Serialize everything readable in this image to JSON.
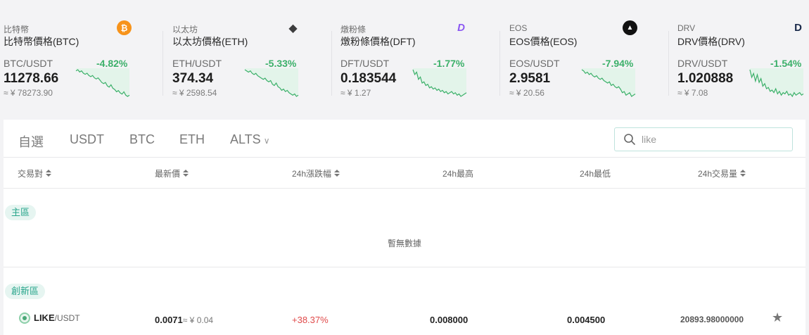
{
  "tickers": [
    {
      "short": "比特幣",
      "full": "比特幣價格(BTC)",
      "pair": "BTC/USDT",
      "change": "-4.82%",
      "price": "11278.66",
      "cny": "≈ ¥ 78273.90",
      "icon": "bitcoin-icon",
      "icon_glyph": "₿",
      "icon_color": "#f7931a",
      "spark": [
        12,
        11,
        13,
        12,
        14,
        15,
        14,
        16,
        17,
        16,
        18,
        19,
        18,
        20,
        22,
        23,
        22,
        25,
        26,
        24,
        27,
        28,
        30,
        29,
        31,
        32,
        30,
        33,
        34,
        33
      ]
    },
    {
      "short": "以太坊",
      "full": "以太坊價格(ETH)",
      "pair": "ETH/USDT",
      "change": "-5.33%",
      "price": "374.34",
      "cny": "≈ ¥ 2598.54",
      "icon": "ethereum-icon",
      "icon_glyph": "◆",
      "icon_color": "#3c3c3d",
      "spark": [
        10,
        11,
        12,
        11,
        13,
        14,
        13,
        15,
        16,
        17,
        18,
        17,
        19,
        20,
        19,
        22,
        23,
        21,
        24,
        25,
        27,
        26,
        28,
        27,
        29,
        30,
        31,
        30,
        32,
        31
      ]
    },
    {
      "short": "燉粉條",
      "full": "燉粉條價格(DFT)",
      "pair": "DFT/USDT",
      "change": "-1.77%",
      "price": "0.183544",
      "cny": "≈ ¥ 1.27",
      "icon": "dft-logo-icon",
      "icon_glyph": "D",
      "icon_color": "#8b57f2",
      "spark": [
        8,
        12,
        10,
        16,
        14,
        19,
        18,
        21,
        20,
        23,
        22,
        24,
        23,
        25,
        24,
        26,
        25,
        27,
        26,
        28,
        27,
        26,
        28,
        27,
        29,
        28,
        30,
        29,
        28,
        27
      ]
    },
    {
      "short": "EOS",
      "full": "EOS價格(EOS)",
      "pair": "EOS/USDT",
      "change": "-7.94%",
      "price": "2.9581",
      "cny": "≈ ¥ 20.56",
      "icon": "eos-icon",
      "icon_glyph": "▲",
      "icon_color": "#111111",
      "spark": [
        9,
        10,
        12,
        11,
        13,
        12,
        14,
        15,
        14,
        16,
        17,
        16,
        18,
        19,
        20,
        19,
        22,
        21,
        23,
        24,
        23,
        25,
        28,
        27,
        30,
        29,
        28,
        31,
        30,
        29
      ]
    },
    {
      "short": "DRV",
      "full": "DRV價格(DRV)",
      "pair": "DRV/USDT",
      "change": "-1.54%",
      "price": "1.020888",
      "cny": "≈ ¥ 7.08",
      "icon": "drv-logo-icon",
      "icon_glyph": "D",
      "icon_color": "#1a2a4a",
      "spark": [
        8,
        14,
        11,
        17,
        12,
        18,
        15,
        21,
        19,
        23,
        22,
        25,
        24,
        26,
        23,
        27,
        25,
        28,
        26,
        27,
        25,
        28,
        27,
        29,
        26,
        28,
        27,
        26,
        28,
        27
      ]
    }
  ],
  "tabs": [
    {
      "label": "自選"
    },
    {
      "label": "USDT"
    },
    {
      "label": "BTC"
    },
    {
      "label": "ETH"
    },
    {
      "label": "ALTS",
      "dropdown": "∨"
    }
  ],
  "search": {
    "value": "like"
  },
  "columns": [
    "交易對",
    "最新價",
    "24h漲跌幅",
    "24h最高",
    "24h最低",
    "24h交易量"
  ],
  "sections": {
    "main": {
      "label": "主區",
      "empty_text": "暫無數據"
    },
    "innovation": {
      "label": "創新區"
    }
  },
  "rows": [
    {
      "base": "LIKE",
      "quote": "/USDT",
      "last": "0.0071",
      "last_cny": "≈ ¥ 0.04",
      "change": "+38.37%",
      "high": "0.008000",
      "low": "0.004500",
      "volume": "20893.98000000",
      "star": "★"
    }
  ],
  "colors": {
    "up": "#3bb069",
    "down": "#e04a4a",
    "accent": "#27a58b"
  }
}
